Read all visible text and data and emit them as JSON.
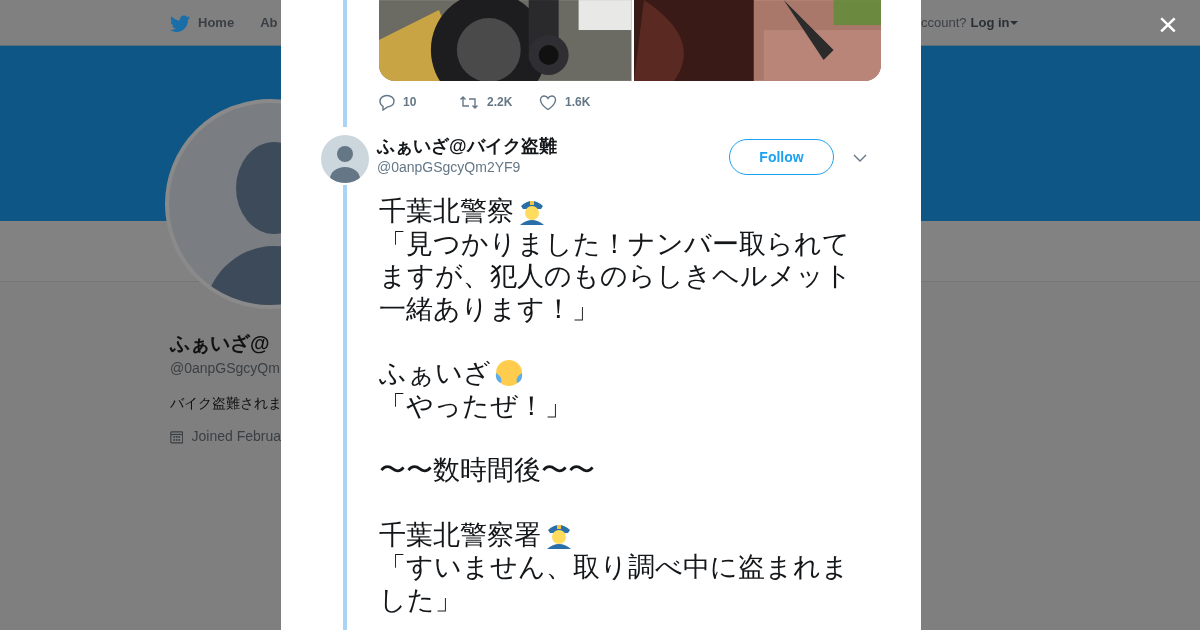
{
  "page_nav": {
    "items": [
      {
        "label": "Home",
        "kind": "brand"
      },
      {
        "label": "Ab"
      }
    ],
    "account_prompt": "ccount?",
    "login": "Log in"
  },
  "profile": {
    "name": "ふぁいざ@",
    "handle": "@0anpGSgcyQm",
    "bio": "バイク盗難されま",
    "joined": "Joined Februa"
  },
  "previous_tweet": {
    "actions": [
      {
        "kind": "reply",
        "count": "10"
      },
      {
        "kind": "retweet",
        "count": "2.2K"
      },
      {
        "kind": "like",
        "count": "1.6K"
      }
    ]
  },
  "tweet": {
    "author": "ふぁいざ@バイク盗難",
    "handle": "@0anpGSgcyQm2YF9",
    "follow": "Follow",
    "body": [
      {
        "kind": "officer",
        "text": "千葉北警察"
      },
      {
        "kind": "quote",
        "text": "「見つかりました！ナンバー取られてますが、犯人のものらしきヘルメット一緒あります！」"
      },
      {
        "kind": "owner",
        "text": "ふぁいざ"
      },
      {
        "kind": "quote",
        "text": "「やったぜ！」"
      },
      {
        "kind": "scene",
        "text": "〜〜数時間後〜〜"
      },
      {
        "kind": "officer",
        "text": "千葉北警察署"
      },
      {
        "kind": "quote",
        "text": "「すいません、取り調べ中に盗まれました」"
      }
    ]
  },
  "close": "×"
}
